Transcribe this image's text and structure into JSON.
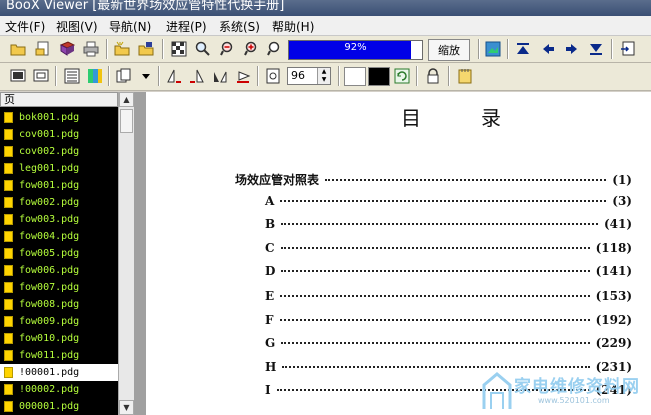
{
  "window": {
    "title": "BooX Viewer [最新世界场效应管特性代换手册]"
  },
  "menu": [
    "文件(F)",
    "视图(V)",
    "导航(N)",
    "进程(P)",
    "系统(S)",
    "帮助(H)"
  ],
  "toolbar": {
    "progress_label": "92%",
    "progress_value": 0.92,
    "zoom_button": "缩放",
    "page_spin_value": "96",
    "fg_color": "#ffffff",
    "bg_color": "#000000"
  },
  "sidebar": {
    "header": "页",
    "files": [
      {
        "name": "bok001.pdg"
      },
      {
        "name": "cov001.pdg"
      },
      {
        "name": "cov002.pdg"
      },
      {
        "name": "leg001.pdg"
      },
      {
        "name": "fow001.pdg"
      },
      {
        "name": "fow002.pdg"
      },
      {
        "name": "fow003.pdg"
      },
      {
        "name": "fow004.pdg"
      },
      {
        "name": "fow005.pdg"
      },
      {
        "name": "fow006.pdg"
      },
      {
        "name": "fow007.pdg"
      },
      {
        "name": "fow008.pdg"
      },
      {
        "name": "fow009.pdg"
      },
      {
        "name": "fow010.pdg"
      },
      {
        "name": "fow011.pdg"
      },
      {
        "name": "!00001.pdg",
        "selected": true
      },
      {
        "name": "!00002.pdg"
      },
      {
        "name": "000001.pdg"
      }
    ]
  },
  "document": {
    "title": "目　录",
    "toc": [
      {
        "label": "场效应管对照表",
        "page": "(1)"
      },
      {
        "label": "A",
        "page": "(3)"
      },
      {
        "label": "B",
        "page": "(41)"
      },
      {
        "label": "C",
        "page": "(118)"
      },
      {
        "label": "D",
        "page": "(141)"
      },
      {
        "label": "E",
        "page": "(153)"
      },
      {
        "label": "F",
        "page": "(192)"
      },
      {
        "label": "G",
        "page": "(229)"
      },
      {
        "label": "H",
        "page": "(231)"
      },
      {
        "label": "I",
        "page": "(241)"
      }
    ]
  },
  "watermark": {
    "text": "家电维修资料网",
    "url": "www.520101.com"
  }
}
